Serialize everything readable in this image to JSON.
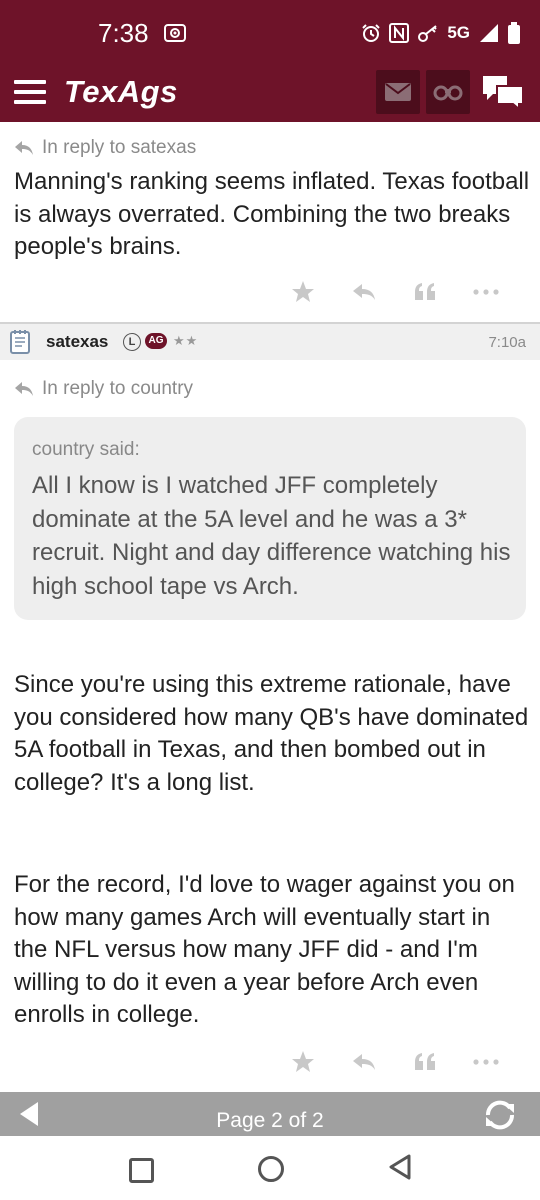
{
  "status_bar": {
    "time": "7:38",
    "network": "5G"
  },
  "header": {
    "logo": "TexAgs"
  },
  "post1": {
    "reply_to": "In reply to satexas",
    "body": "Manning's ranking seems inflated. Texas football is always overrated. Combining the two breaks people's brains."
  },
  "post2": {
    "username": "satexas",
    "badge_l": "L",
    "badge_ag": "AG",
    "stars": "★★",
    "time": "7:10a",
    "reply_to": "In reply to country",
    "quote": {
      "author": "country said:",
      "text": "All I know is I watched JFF completely dominate at the 5A level and he was a 3* recruit. Night and day difference watching his high school tape vs Arch."
    },
    "body_p1": "Since you're using this extreme rationale, have you considered how many QB's have dominated 5A football in Texas, and then bombed out in college? It's a long list.",
    "body_p2": "For the record, I'd love to wager against you on how many games Arch will eventually start in the NFL versus how many JFF did - and I'm willing to do it even a year before Arch even enrolls in college."
  },
  "pagination": {
    "label": "Page 2 of 2"
  },
  "colors": {
    "brand": "#6e1329",
    "brand_dark": "#4c0d1c",
    "action_icons": "#c8c8c8"
  }
}
